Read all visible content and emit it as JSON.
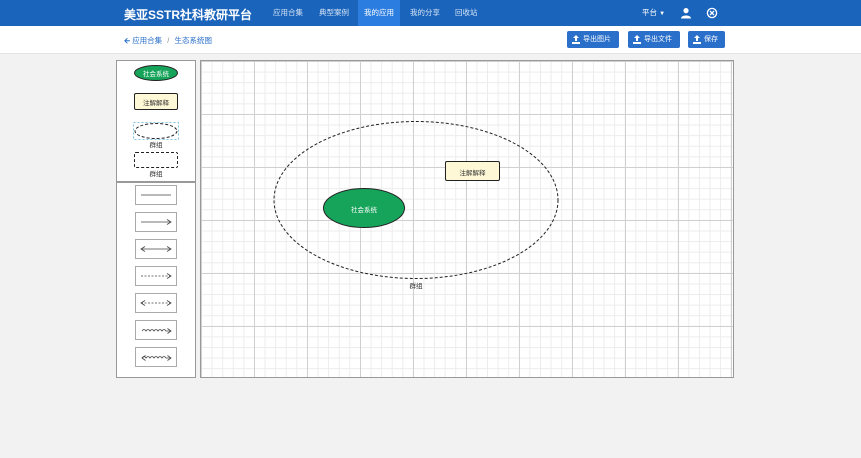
{
  "app": {
    "title": "美亚SSTR社科教研平台"
  },
  "nav": {
    "items": [
      {
        "label": "应用合集",
        "active": false
      },
      {
        "label": "典型案例",
        "active": false
      },
      {
        "label": "我的应用",
        "active": true
      },
      {
        "label": "我的分享",
        "active": false
      },
      {
        "label": "回收站",
        "active": false
      }
    ],
    "platform_label": "平台",
    "user_icon": "user-icon",
    "close_icon": "close-circle-icon"
  },
  "breadcrumb": {
    "parent": "应用合集",
    "separator": "/",
    "current": "生态系统图"
  },
  "toolbar": {
    "export_image": "导出图片",
    "export_file": "导出文件",
    "save": "保存"
  },
  "palette": {
    "shapes": [
      {
        "type": "ellipse-green",
        "label": "社会系统"
      },
      {
        "type": "note",
        "label": "注解解释"
      },
      {
        "type": "group-ellipse",
        "label": "群组"
      },
      {
        "type": "group-rect",
        "label": "群组"
      }
    ],
    "connectors": [
      "solid-line",
      "arrow-right",
      "arrow-both",
      "dashed-arrow-right",
      "dashed-arrow-both",
      "wavy-arrow-right",
      "wavy-arrow-both"
    ]
  },
  "diagram": {
    "group_label": "群组",
    "system_node_label": "社会系统",
    "note_label": "注解解释"
  },
  "colors": {
    "nav": "#1b64bb",
    "nav_active": "#2c7de0",
    "button": "#2a6fc9",
    "node_green": "#16a35a",
    "note_bg": "#fff8d6"
  }
}
